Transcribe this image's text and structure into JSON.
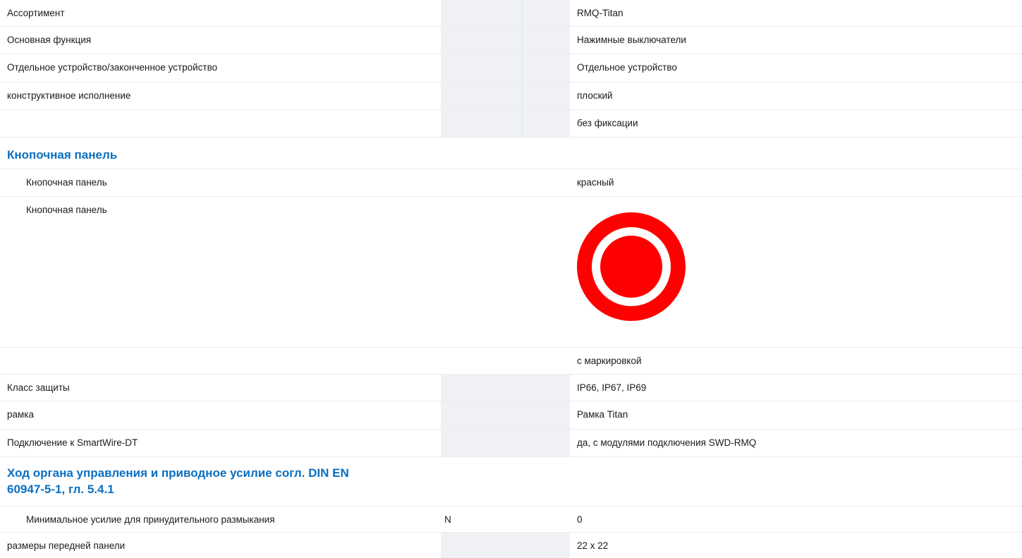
{
  "rows": [
    {
      "label": "Ассортимент",
      "value": "RMQ-Titan"
    },
    {
      "label": "Основная функция",
      "value": "Нажимные выключатели"
    },
    {
      "label": "Отдельное устройство/законченное устройство",
      "value": "Отдельное устройство"
    },
    {
      "label": "конструктивное исполнение",
      "value": "плоский"
    },
    {
      "label": "",
      "value": "без фиксации"
    }
  ],
  "section_keypad": {
    "heading": "Кнопочная панель",
    "row_color": {
      "label": "Кнопочная панель",
      "value": "красный"
    },
    "row_image": {
      "label": "Кнопочная панель",
      "icon": "red-pushbutton-icon",
      "color": "#ff0000"
    },
    "row_marking": {
      "label": "",
      "value": "с маркировкой"
    }
  },
  "rows2": [
    {
      "label": "Класс защиты",
      "value": "IP66, IP67, IP69"
    },
    {
      "label": "рамка",
      "value": "Рамка Titan"
    },
    {
      "label": "Подключение к SmartWire-DT",
      "value": "да, с модулями подключения SWD-RMQ"
    }
  ],
  "section_travel": {
    "heading_line1": "Ход органа управления и приводное усилие согл. DIN EN",
    "heading_line2": "60947-5-1, гл. 5.4.1",
    "row_force": {
      "label": "Минимальное усилие для принудительного размыкания",
      "unit": "N",
      "value": "0"
    }
  },
  "row_last": {
    "label": "размеры передней панели",
    "value": "22 x 22"
  },
  "colors": {
    "heading": "#0a6fc2",
    "grey_band": "#eff1f4"
  }
}
